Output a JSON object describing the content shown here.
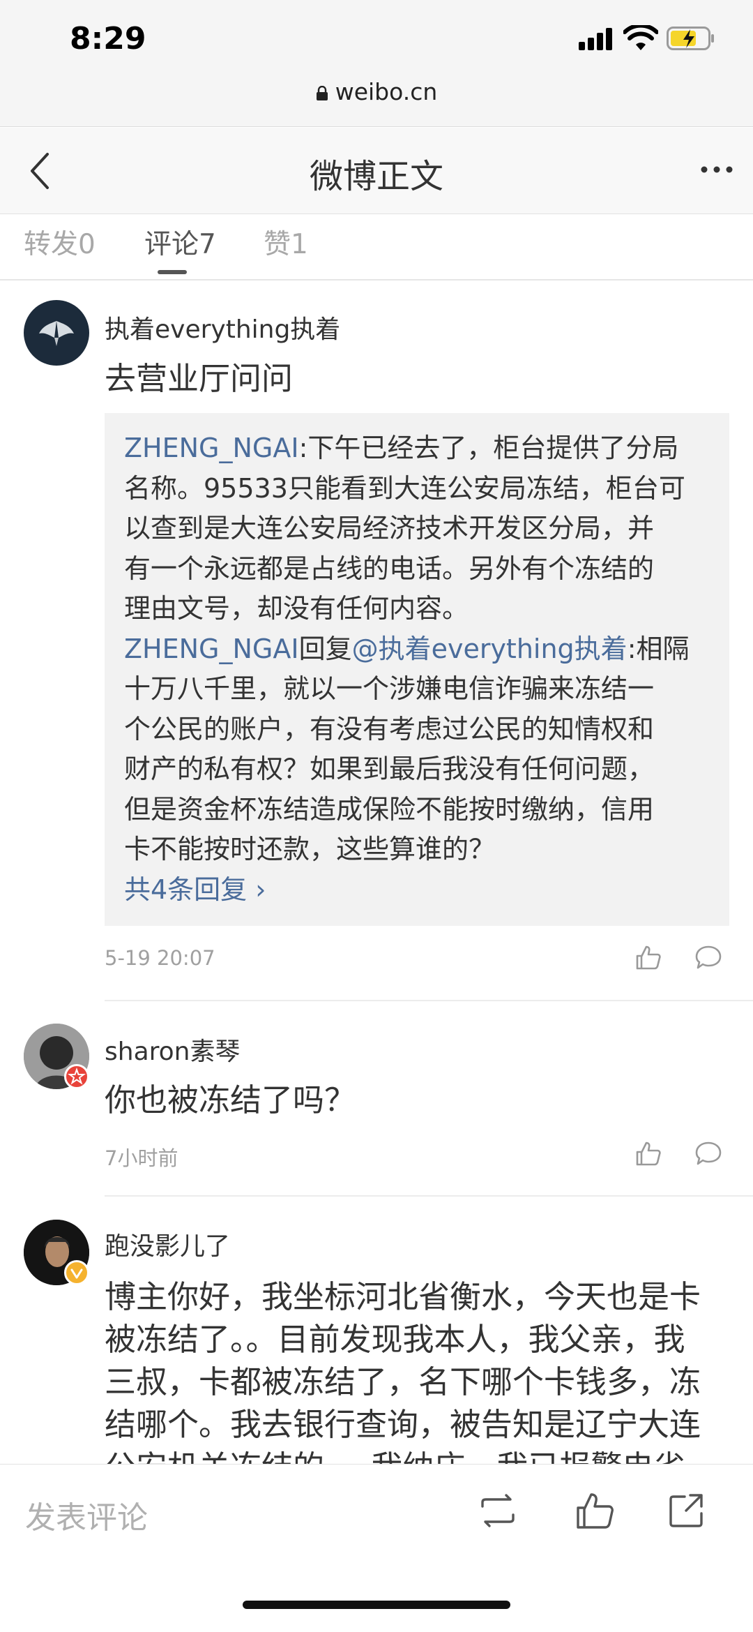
{
  "status_bar": {
    "time": "8:29",
    "url": "weibo.cn"
  },
  "nav": {
    "title": "微博正文"
  },
  "tabs": [
    {
      "label": "转发0"
    },
    {
      "label": "评论7"
    },
    {
      "label": "赞1"
    }
  ],
  "comments": [
    {
      "username": "执着everything执着",
      "text": "去营业厅问问",
      "replies_line1_user": "ZHENG_NGAI",
      "replies_line1_text": ":下午已经去了，柜台提供了分局",
      "replies_line2": "名称。95533只能看到大连公安局冻结，柜台可",
      "replies_line3": "以查到是大连公安局经济技术开发区分局，并",
      "replies_line4": "有一个永远都是占线的电话。另外有个冻结的",
      "replies_line5": "理由文号，却没有任何内容。",
      "reply2_user": "ZHENG_NGAI",
      "reply2_verb": "回复",
      "reply2_mention": "@执着everything执着",
      "reply2_line1": ":相隔",
      "reply2_line2": "十万八千里，就以一个涉嫌电信诈骗来冻结一",
      "reply2_line3": "个公民的账户，有没有考虑过公民的知情权和",
      "reply2_line4": "财产的私有权？如果到最后我没有任何问题，",
      "reply2_line5": "但是资金杯冻结造成保险不能按时缴纳，信用",
      "reply2_line6": "卡不能按时还款，这些算谁的？",
      "more_replies": "共4条回复",
      "time": "5-19 20:07"
    },
    {
      "username": "sharon素琴",
      "text": "你也被冻结了吗？",
      "time": "7小时前"
    },
    {
      "username": "跑没影儿了",
      "line1": "博主你好，我坐标河北省衡水，今天也是卡",
      "line2": "被冻结了。。目前发现我本人，我父亲，我",
      "line3": "三叔，卡都被冻结了，名下哪个卡钱多，冻",
      "line4": "结哪个。我去银行查询，被告知是辽宁大连",
      "line5": "公安机关冻结的。。我纳庄，我已报警电省"
    }
  ],
  "bottom_bar": {
    "compose_placeholder": "发表评论"
  },
  "colors": {
    "link": "#4a6c9b",
    "badge_red": "#e8433a",
    "badge_gold": "#f5b22e"
  }
}
